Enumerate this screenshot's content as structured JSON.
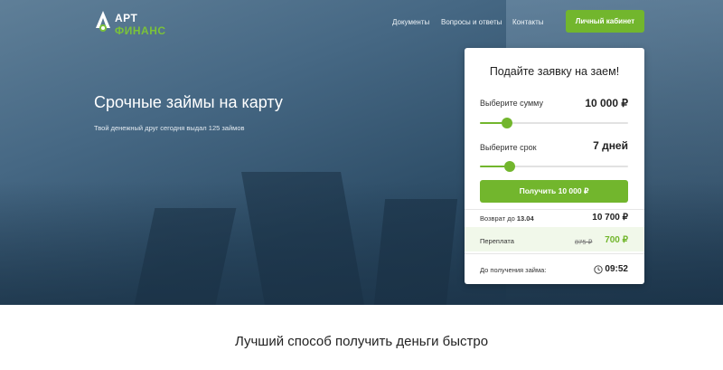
{
  "brand": {
    "line1": "АРТ",
    "line2": "ФИНАНС",
    "accent_color": "#72b62d"
  },
  "nav": {
    "items": [
      "Документы",
      "Вопросы и ответы",
      "Контакты"
    ],
    "cabinet_label": "Личный кабинет"
  },
  "hero": {
    "title": "Срочные займы на карту",
    "subtitle": "Твой денежный друг сегодня выдал 125 займов"
  },
  "loan_form": {
    "title": "Подайте заявку на заем!",
    "amount_label": "Выберите сумму",
    "amount_value": "10 000 ₽",
    "amount_fraction": 0.18,
    "term_label": "Выберите срок",
    "term_value": "7 дней",
    "term_fraction": 0.2,
    "submit_label": "Получить  10 000 ₽",
    "return_label": "Возврат до",
    "return_date": "13.04",
    "return_amount": "10 700 ₽",
    "overpay_label": "Переплата",
    "overpay_old": "875 ₽",
    "overpay_new": "700 ₽",
    "timer_label": "До получения займа:",
    "timer_value": "09:52",
    "timer_icon": "clock-icon"
  },
  "section": {
    "title": "Лучший способ получить деньги быстро"
  }
}
